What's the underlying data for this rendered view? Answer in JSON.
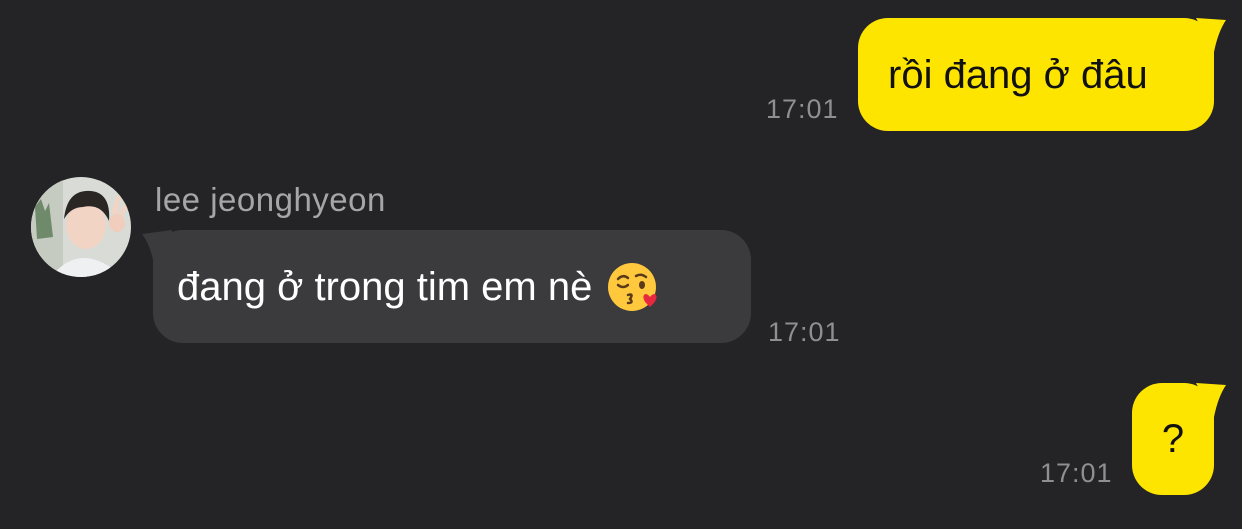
{
  "messages": [
    {
      "direction": "outgoing",
      "text": "rồi đang ở đâu",
      "time": "17:01"
    },
    {
      "direction": "incoming",
      "sender": "lee jeonghyeon",
      "text": "đang ở trong tim em nè",
      "emoji": "face-blowing-a-kiss",
      "time": "17:01"
    },
    {
      "direction": "outgoing",
      "text": "?",
      "time": "17:01"
    }
  ],
  "colors": {
    "background": "#242426",
    "outgoing_bubble": "#fee500",
    "incoming_bubble": "#3b3b3d",
    "timestamp": "#8e8e93",
    "sender_name": "#a5a5aa"
  }
}
